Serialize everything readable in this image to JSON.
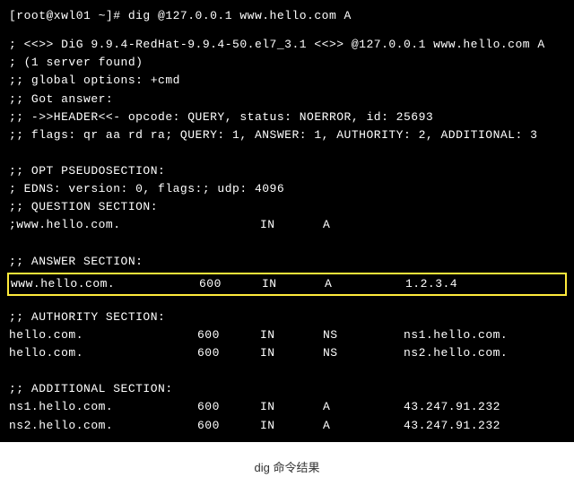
{
  "prompt": "[root@xwl01 ~]# dig @127.0.0.1 www.hello.com A",
  "header_lines": [
    "; <<>> DiG 9.9.4-RedHat-9.9.4-50.el7_3.1 <<>> @127.0.0.1 www.hello.com A",
    "; (1 server found)",
    ";; global options: +cmd",
    ";; Got answer:",
    ";; ->>HEADER<<- opcode: QUERY, status: NOERROR, id: 25693",
    ";; flags: qr aa rd ra; QUERY: 1, ANSWER: 1, AUTHORITY: 2, ADDITIONAL: 3"
  ],
  "opt_section_label": ";; OPT PSEUDOSECTION:",
  "edns_line": "; EDNS: version: 0, flags:; udp: 4096",
  "question_section_label": ";; QUESTION SECTION:",
  "question": {
    "name": ";www.hello.com.",
    "class": "IN",
    "type": "A"
  },
  "answer_section_label": ";; ANSWER SECTION:",
  "answer": {
    "name": "www.hello.com.",
    "ttl": "600",
    "class": "IN",
    "type": "A",
    "data": "1.2.3.4"
  },
  "authority_section_label": ";; AUTHORITY SECTION:",
  "authority": [
    {
      "name": "hello.com.",
      "ttl": "600",
      "class": "IN",
      "type": "NS",
      "data": "ns1.hello.com."
    },
    {
      "name": "hello.com.",
      "ttl": "600",
      "class": "IN",
      "type": "NS",
      "data": "ns2.hello.com."
    }
  ],
  "additional_section_label": ";; ADDITIONAL SECTION:",
  "additional": [
    {
      "name": "ns1.hello.com.",
      "ttl": "600",
      "class": "IN",
      "type": "A",
      "data": "43.247.91.232"
    },
    {
      "name": "ns2.hello.com.",
      "ttl": "600",
      "class": "IN",
      "type": "A",
      "data": "43.247.91.232"
    }
  ],
  "caption": "dig 命令结果"
}
